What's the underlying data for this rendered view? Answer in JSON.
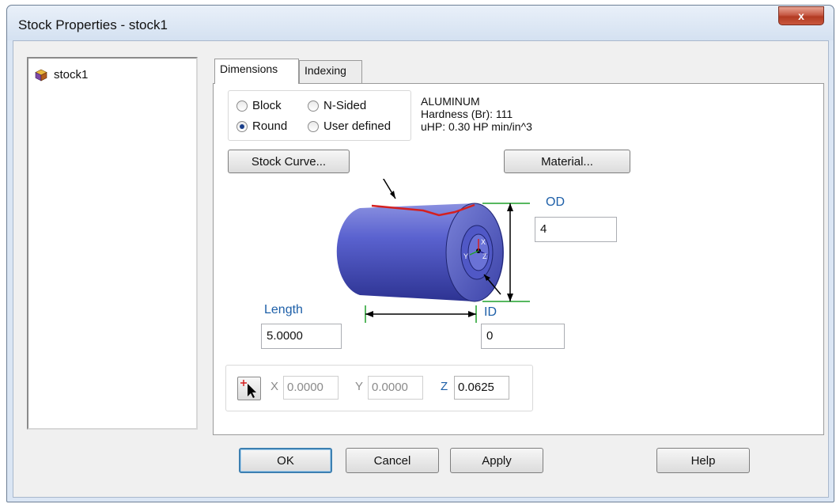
{
  "window": {
    "title": "Stock Properties - stock1",
    "close_label": "x"
  },
  "tree": {
    "items": [
      {
        "label": "stock1",
        "icon": "stock-cube-icon"
      }
    ]
  },
  "tabs": [
    {
      "label": "Dimensions",
      "active": true
    },
    {
      "label": "Indexing",
      "active": false
    }
  ],
  "shape": {
    "options": [
      {
        "label": "Block",
        "selected": false
      },
      {
        "label": "N-Sided",
        "selected": false
      },
      {
        "label": "Round",
        "selected": true
      },
      {
        "label": "User defined",
        "selected": false
      }
    ]
  },
  "material": {
    "name": "ALUMINUM",
    "hardness": "Hardness (Br):  111",
    "uhp": "uHP: 0.30 HP min/in^3"
  },
  "buttons": {
    "stock_curve": "Stock Curve...",
    "material": "Material...",
    "ok": "OK",
    "cancel": "Cancel",
    "apply": "Apply",
    "help": "Help"
  },
  "dimensions": {
    "od_label": "OD",
    "od_value": "4",
    "length_label": "Length",
    "length_value": "5.0000",
    "id_label": "ID",
    "id_value": "0"
  },
  "origin": {
    "x_label": "X",
    "x_value": "0.0000",
    "y_label": "Y",
    "y_value": "0.0000",
    "z_label": "Z",
    "z_value": "0.0625"
  },
  "colors": {
    "accent": "#1d5fa8",
    "cylinder": "#4f58c9",
    "curve": "#d42020"
  }
}
